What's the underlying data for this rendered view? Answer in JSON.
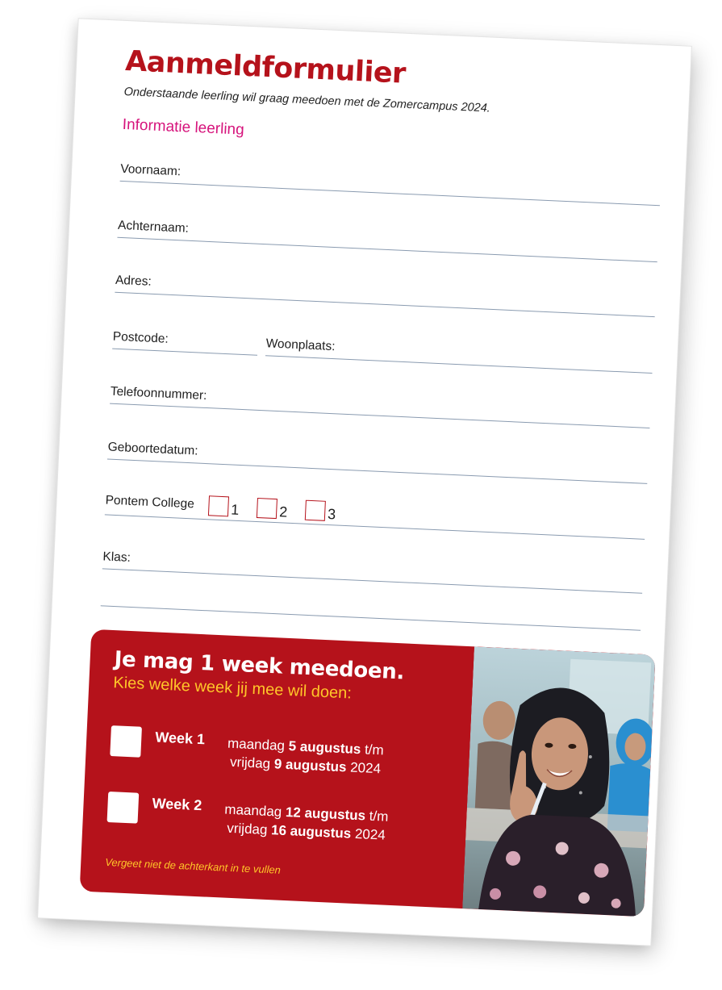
{
  "form": {
    "title": "Aanmeldformulier",
    "subtitle": "Onderstaande leerling wil graag meedoen met de Zomercampus 2024.",
    "section": "Informatie leerling",
    "fields": {
      "voornaam": "Voornaam:",
      "achternaam": "Achternaam:",
      "adres": "Adres:",
      "postcode": "Postcode:",
      "woonplaats": "Woonplaats:",
      "telefoon": "Telefoonnummer:",
      "geboortedatum": "Geboortedatum:",
      "college": "Pontem College",
      "klas": "Klas:"
    },
    "college_options": [
      "1",
      "2",
      "3"
    ]
  },
  "promo": {
    "heading": "Je mag 1 week meedoen.",
    "subheading": "Kies welke week jij mee wil doen:",
    "weeks": [
      {
        "label": "Week 1",
        "line1_pre": "maandag ",
        "line1_bold": "5 augustus",
        "line1_post": " t/m",
        "line2_pre": "vrijdag ",
        "line2_bold": "9 augustus",
        "line2_post": " 2024"
      },
      {
        "label": "Week 2",
        "line1_pre": "maandag ",
        "line1_bold": "12 augustus",
        "line1_post": " t/m",
        "line2_pre": "vrijdag ",
        "line2_bold": "16 augustus",
        "line2_post": " 2024"
      }
    ],
    "footer": "Vergeet niet de achterkant in te vullen"
  },
  "colors": {
    "brand_red": "#b5121b",
    "section_magenta": "#d6147c",
    "accent_yellow": "#ffc629"
  }
}
